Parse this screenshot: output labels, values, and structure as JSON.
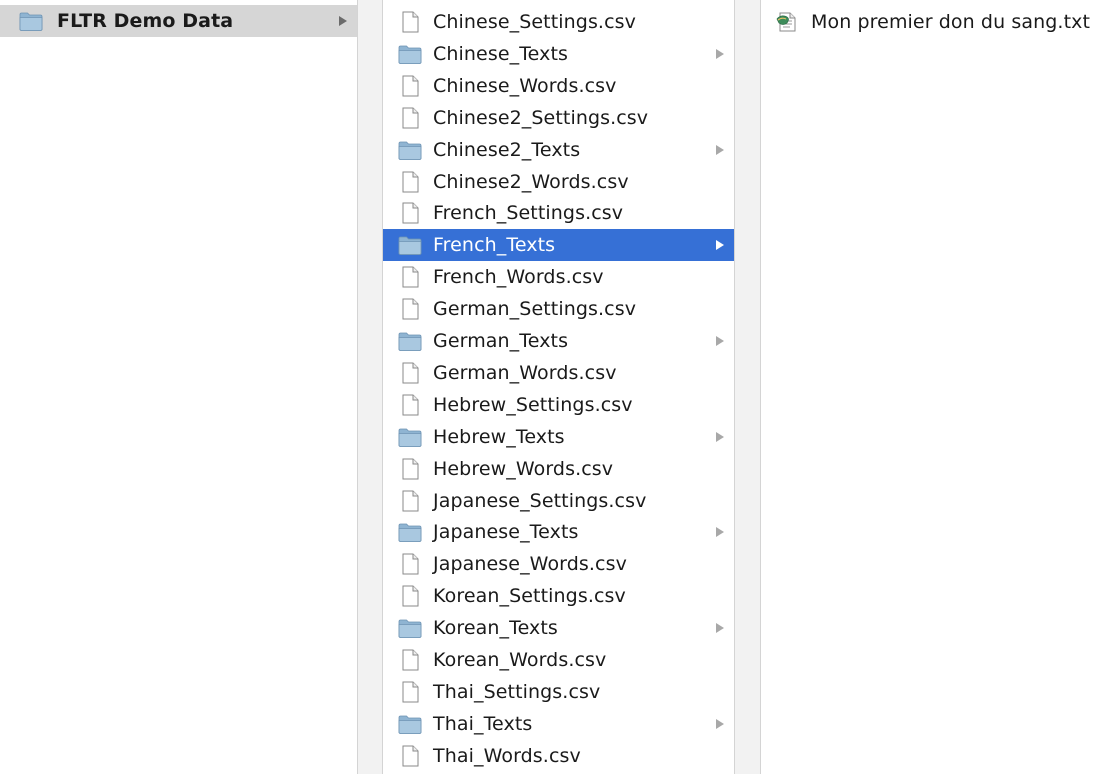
{
  "column1": {
    "items": [
      {
        "label": "FLTR Demo Data",
        "type": "folder",
        "state": "muted"
      }
    ]
  },
  "column2": {
    "items": [
      {
        "label": "Chinese_Settings.csv",
        "type": "file"
      },
      {
        "label": "Chinese_Texts",
        "type": "folder"
      },
      {
        "label": "Chinese_Words.csv",
        "type": "file"
      },
      {
        "label": "Chinese2_Settings.csv",
        "type": "file"
      },
      {
        "label": "Chinese2_Texts",
        "type": "folder"
      },
      {
        "label": "Chinese2_Words.csv",
        "type": "file"
      },
      {
        "label": "French_Settings.csv",
        "type": "file"
      },
      {
        "label": "French_Texts",
        "type": "folder",
        "state": "selected"
      },
      {
        "label": "French_Words.csv",
        "type": "file"
      },
      {
        "label": "German_Settings.csv",
        "type": "file"
      },
      {
        "label": "German_Texts",
        "type": "folder"
      },
      {
        "label": "German_Words.csv",
        "type": "file"
      },
      {
        "label": "Hebrew_Settings.csv",
        "type": "file"
      },
      {
        "label": "Hebrew_Texts",
        "type": "folder"
      },
      {
        "label": "Hebrew_Words.csv",
        "type": "file"
      },
      {
        "label": "Japanese_Settings.csv",
        "type": "file"
      },
      {
        "label": "Japanese_Texts",
        "type": "folder"
      },
      {
        "label": "Japanese_Words.csv",
        "type": "file"
      },
      {
        "label": "Korean_Settings.csv",
        "type": "file"
      },
      {
        "label": "Korean_Texts",
        "type": "folder"
      },
      {
        "label": "Korean_Words.csv",
        "type": "file"
      },
      {
        "label": "Thai_Settings.csv",
        "type": "file"
      },
      {
        "label": "Thai_Texts",
        "type": "folder"
      },
      {
        "label": "Thai_Words.csv",
        "type": "file"
      }
    ]
  },
  "column3": {
    "items": [
      {
        "label": "Mon premier don du sang.txt",
        "type": "text-document"
      }
    ]
  },
  "icons": {
    "folder": "folder-icon",
    "file": "document-icon",
    "text-document": "text-document-icon",
    "arrow": "disclosure-arrow-icon"
  },
  "colors": {
    "selection": "#3670d6",
    "inactive_selection": "#d6d6d6",
    "folder_fill": "#9fc0d8"
  }
}
